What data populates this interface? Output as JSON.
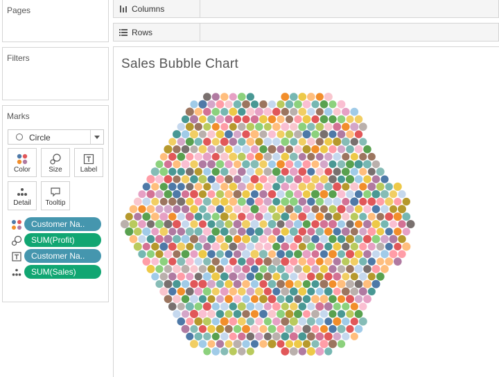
{
  "panels": {
    "pages_title": "Pages",
    "filters_title": "Filters",
    "marks_title": "Marks"
  },
  "marks": {
    "mark_type": "Circle",
    "cards": {
      "color": "Color",
      "size": "Size",
      "label": "Label",
      "detail": "Detail",
      "tooltip": "Tooltip"
    },
    "fields": [
      {
        "icon": "color-dots-icon",
        "label": "Customer Na..",
        "color": "#4596ae"
      },
      {
        "icon": "size-icon",
        "label": "SUM(Profit)",
        "color": "#11a672"
      },
      {
        "icon": "label-icon",
        "label": "Customer Na..",
        "color": "#4596ae"
      },
      {
        "icon": "detail-dots-icon",
        "label": "SUM(Sales)",
        "color": "#11a672"
      }
    ]
  },
  "shelves": {
    "columns": "Columns",
    "rows": "Rows"
  },
  "view": {
    "title": "Sales Bubble Chart"
  },
  "chart_data": {
    "type": "scatter",
    "title": "Sales Bubble Chart",
    "mark": "circle",
    "color_by": "Customer Name",
    "size_by": "SUM(Profit)",
    "label_by": "Customer Name",
    "detail_by": "SUM(Sales)",
    "palette": [
      "#e15759",
      "#f28e2b",
      "#59a14f",
      "#edc948",
      "#4e79a7",
      "#76b7b2",
      "#b07aa1",
      "#ff9da7",
      "#9c755f",
      "#bab0ac",
      "#8cd17d",
      "#a0cbe8",
      "#ffbe7d",
      "#d4a6c8",
      "#79706e",
      "#b6992d",
      "#fabfd2",
      "#86bcb6",
      "#f1ce63",
      "#499894",
      "#d37295",
      "#e6a0c4",
      "#b9ca5d",
      "#c5d8ee",
      "#f9c6ce"
    ]
  }
}
